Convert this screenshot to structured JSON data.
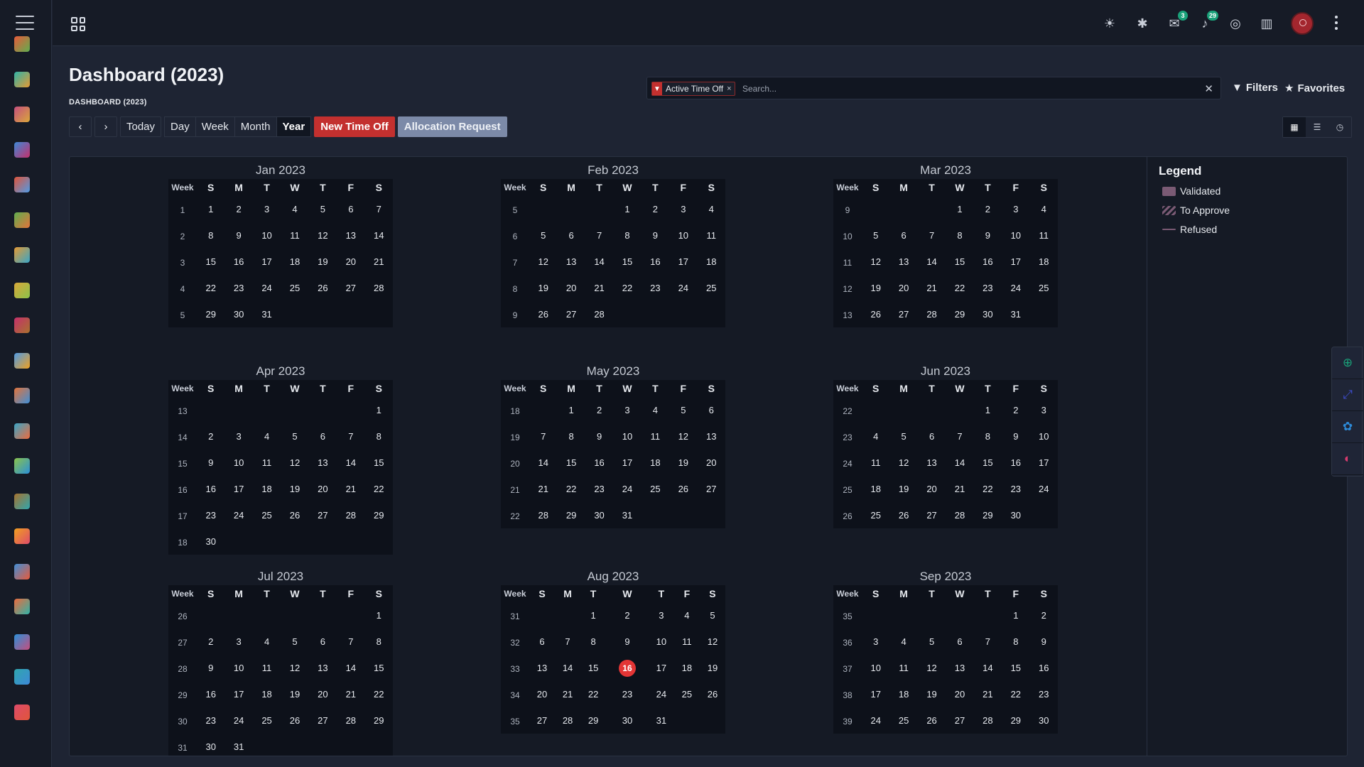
{
  "topbar": {
    "badge_discuss": "3",
    "badge_activity": "29"
  },
  "page": {
    "title": "Dashboard (2023)",
    "breadcrumb": "DASHBOARD (2023)"
  },
  "search": {
    "facet_label": "Active Time Off",
    "facet_remove": "×",
    "placeholder": "Search...",
    "filters_label": "Filters",
    "favorites_label": "Favorites"
  },
  "toolbar": {
    "prev": "‹",
    "next": "›",
    "today": "Today",
    "day": "Day",
    "week": "Week",
    "month": "Month",
    "year": "Year",
    "new_time_off": "New Time Off",
    "allocation_request": "Allocation Request"
  },
  "legend": {
    "title": "Legend",
    "items": [
      "Validated",
      "To Approve",
      "Refused"
    ]
  },
  "calendar": {
    "week_header": "Week",
    "day_headers": [
      "S",
      "M",
      "T",
      "W",
      "T",
      "F",
      "S"
    ],
    "today": {
      "month": 7,
      "day": 16
    },
    "months": [
      {
        "title": "Jan 2023",
        "start": 0,
        "days": 31,
        "first_week": 1
      },
      {
        "title": "Feb 2023",
        "start": 3,
        "days": 28,
        "first_week": 5
      },
      {
        "title": "Mar 2023",
        "start": 3,
        "days": 31,
        "first_week": 9
      },
      {
        "title": "Apr 2023",
        "start": 6,
        "days": 30,
        "first_week": 13
      },
      {
        "title": "May 2023",
        "start": 1,
        "days": 31,
        "first_week": 18
      },
      {
        "title": "Jun 2023",
        "start": 4,
        "days": 30,
        "first_week": 22
      },
      {
        "title": "Jul 2023",
        "start": 6,
        "days": 31,
        "first_week": 26
      },
      {
        "title": "Aug 2023",
        "start": 2,
        "days": 31,
        "first_week": 31
      },
      {
        "title": "Sep 2023",
        "start": 5,
        "days": 30,
        "first_week": 35
      }
    ]
  },
  "colors": {
    "accent_red": "#c3302f",
    "today_red": "#e33535",
    "badge_green": "#1aa179",
    "legend_color": "#7a5a74"
  },
  "sidebar_apps": [
    "dashboard-app-icon",
    "documents-app-icon",
    "inventory-app-icon",
    "projects-app-icon",
    "notes-app-icon",
    "crm-app-icon",
    "purchase-app-icon",
    "manufacturing-app-icon",
    "pos-app-icon",
    "maintenance-app-icon",
    "employees-app-icon",
    "fleet-app-icon",
    "recruitment-app-icon",
    "wallet-app-icon",
    "appraisal-app-icon",
    "livechat-app-icon",
    "reports-app-icon",
    "website-app-icon",
    "apps-app-icon",
    "settings-app-icon"
  ]
}
